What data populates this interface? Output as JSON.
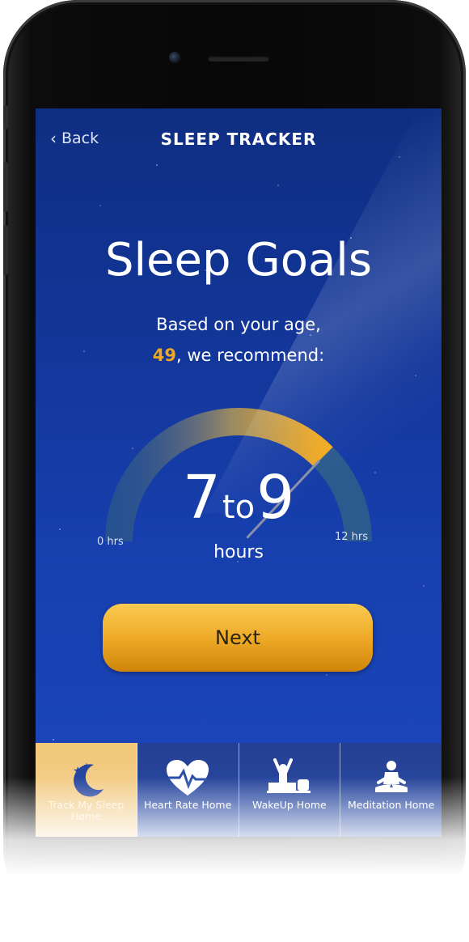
{
  "nav": {
    "back_label": "Back",
    "title": "SLEEP TRACKER"
  },
  "main": {
    "heading": "Sleep Goals",
    "subtitle_line1": "Based on your age,",
    "age": "49",
    "subtitle_line2_suffix": ", we recommend:",
    "range_low": "7",
    "range_separator": "to",
    "range_high": "9",
    "range_unit": "hours",
    "gauge_min_label": "0 hrs",
    "gauge_max_label": "12 hrs",
    "gauge": {
      "min": 0,
      "max": 12,
      "highlight_from": 0,
      "highlight_to": 9,
      "needle": 9
    },
    "next_label": "Next"
  },
  "tabs": [
    {
      "label": "Track My Sleep Home",
      "icon": "moon-stars-icon",
      "active": true
    },
    {
      "label": "Heart Rate Home",
      "icon": "heart-pulse-icon",
      "active": false
    },
    {
      "label": "WakeUp Home",
      "icon": "stretch-person-icon",
      "active": false
    },
    {
      "label": "Meditation Home",
      "icon": "meditation-icon",
      "active": false
    }
  ],
  "colors": {
    "screen_bg": "#123597",
    "accent": "#f0a81f",
    "button": "#efaa28",
    "active_tab": "#f2c878"
  }
}
